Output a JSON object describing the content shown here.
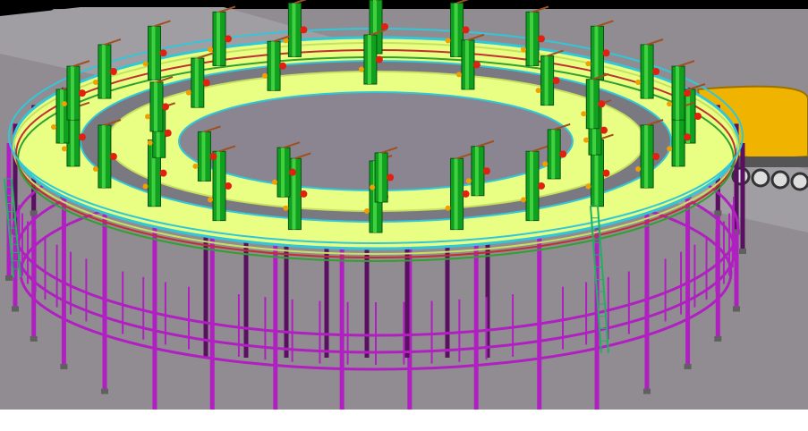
{
  "scene": {
    "subject": "circular-pipe-rack-3d-model",
    "colors": {
      "sky": "#000000",
      "ground": "#918c92",
      "ground_far": "#a8a4a8",
      "road": "#8a8a8a",
      "deck": "#e9ff84",
      "deck_edge": "#c8e060",
      "railing": "#30c8d8",
      "columns": "#b020c0",
      "columns_dark": "#5a1060",
      "vessels": "#10a020",
      "vessels_light": "#40d040",
      "valves_red": "#e02010",
      "valves_orange": "#f0a000",
      "pipes_brown": "#a05020",
      "pipes_violet": "#8040c0",
      "ladder": "#20b060",
      "footing": "#606060",
      "truck_tank": "#f0b400"
    }
  }
}
